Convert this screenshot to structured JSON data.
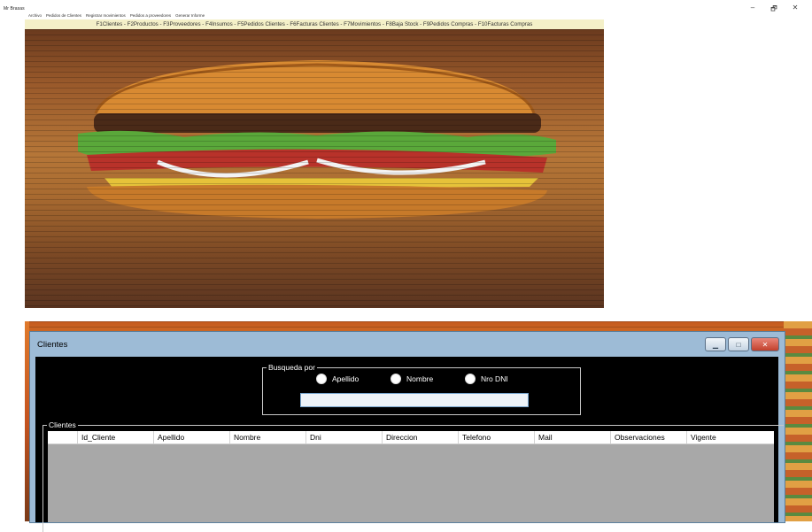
{
  "app": {
    "title": "Mr Brasas",
    "controls": {
      "minimize": "–",
      "maximize": "🗗",
      "close": "✕"
    }
  },
  "menubar": [
    "Archivo",
    "Pedidos de Clientes",
    "Registrar movimientos",
    "Pedidos a proveedores",
    "Generar Informe"
  ],
  "shortcuts": "F1Clientes - F2Productos - F3Proveedores - F4Insumos - F5Pedidos Clientes - F6Facturas Clientes - F7Movimientos - F8Baja Stock - F9Pedidos Compras - F10Facturas Compras",
  "clientes_window": {
    "title": "Clientes",
    "busqueda": {
      "legend": "Busqueda por",
      "options": [
        "Apellido",
        "Nombre",
        "Nro DNI"
      ],
      "input_value": ""
    },
    "clientes_group": {
      "legend": "Clientes",
      "columns": [
        "",
        "Id_Cliente",
        "Apellido",
        "Nombre",
        "Dni",
        "Direccion",
        "Telefono",
        "Mail",
        "Observaciones",
        "Vigente"
      ]
    }
  },
  "colors": {
    "shortcut_bar": "#f4f0c8",
    "child_titlebar": "#9dbbd6",
    "close_button": "#c2402c"
  }
}
